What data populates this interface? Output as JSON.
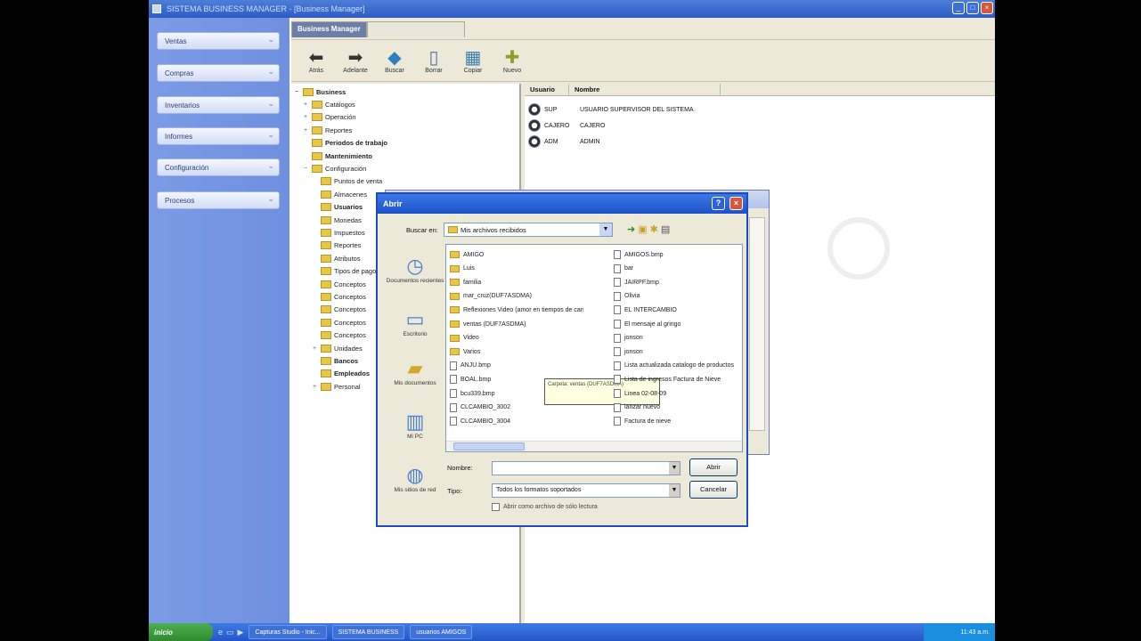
{
  "window": {
    "title": "SISTEMA BUSINESS MANAGER - [Business Manager]"
  },
  "leftnav": {
    "items": [
      {
        "label": "Ventas"
      },
      {
        "label": "Compras"
      },
      {
        "label": "Inventarios"
      },
      {
        "label": "Informes"
      },
      {
        "label": "Configuración"
      },
      {
        "label": "Procesos"
      }
    ]
  },
  "tabs": [
    {
      "label": "Business Manager"
    },
    {
      "label": ""
    }
  ],
  "toolbar": {
    "buttons": [
      {
        "label": "Atrás",
        "icon": "back-arrow-icon"
      },
      {
        "label": "Adelante",
        "icon": "forward-arrow-icon"
      },
      {
        "label": "Buscar",
        "icon": "search-icon"
      },
      {
        "label": "Borrar",
        "icon": "trash-icon"
      },
      {
        "label": "Copiar",
        "icon": "grid-icon"
      },
      {
        "label": "Nuevo",
        "icon": "new-icon"
      }
    ]
  },
  "tree": {
    "items": [
      {
        "label": "Business",
        "bold": true,
        "exp": "−",
        "level": 0
      },
      {
        "label": "Catálogos",
        "exp": "+",
        "level": 1
      },
      {
        "label": "Operación",
        "exp": "+",
        "level": 1
      },
      {
        "label": "Reportes",
        "exp": "+",
        "level": 1
      },
      {
        "label": "Periodos de trabajo",
        "bold": true,
        "exp": "",
        "level": 1
      },
      {
        "label": "Mantenimiento",
        "bold": true,
        "exp": "",
        "level": 1
      },
      {
        "label": "Configuración",
        "exp": "−",
        "level": 1
      },
      {
        "label": "Puntos de venta",
        "exp": "",
        "level": 2
      },
      {
        "label": "Almacenes",
        "exp": "",
        "level": 2
      },
      {
        "label": "Usuarios",
        "bold": true,
        "exp": "",
        "level": 2
      },
      {
        "label": "Monedas",
        "exp": "",
        "level": 2
      },
      {
        "label": "Impuestos",
        "exp": "",
        "level": 2
      },
      {
        "label": "Reportes",
        "exp": "",
        "level": 2
      },
      {
        "label": "Atributos",
        "exp": "",
        "level": 2
      },
      {
        "label": "Tipos de pago",
        "exp": "",
        "level": 2
      },
      {
        "label": "Conceptos",
        "exp": "",
        "level": 2
      },
      {
        "label": "Conceptos",
        "exp": "",
        "level": 2
      },
      {
        "label": "Conceptos",
        "exp": "",
        "level": 2
      },
      {
        "label": "Conceptos",
        "exp": "",
        "level": 2
      },
      {
        "label": "Conceptos",
        "exp": "",
        "level": 2
      },
      {
        "label": "Unidades",
        "exp": "+",
        "level": 2
      },
      {
        "label": "Bancos",
        "bold": true,
        "exp": "",
        "level": 2
      },
      {
        "label": "Empleados",
        "bold": true,
        "exp": "",
        "level": 2
      },
      {
        "label": "Personal",
        "exp": "+",
        "level": 2
      }
    ]
  },
  "list": {
    "headers": [
      "Usuario",
      "Nombre"
    ],
    "rows": [
      {
        "user": "SUP",
        "name": "USUARIO SUPERVISOR DEL SISTEMA"
      },
      {
        "user": "CAJERO",
        "name": "CAJERO"
      },
      {
        "user": "ADM",
        "name": "ADMIN"
      }
    ]
  },
  "dialog": {
    "title": "Abrir",
    "lookin_label": "Buscar en:",
    "lookin_value": "Mis archivos recibidos",
    "places": [
      {
        "label": "Documentos recientes",
        "icon": "recent-docs-icon"
      },
      {
        "label": "Escritorio",
        "icon": "desktop-icon"
      },
      {
        "label": "Mis documentos",
        "icon": "my-documents-icon"
      },
      {
        "label": "Mi PC",
        "icon": "my-computer-icon"
      },
      {
        "label": "Mis sitios de red",
        "icon": "network-icon"
      }
    ],
    "files_left": [
      {
        "name": "AMIGO",
        "type": "folder"
      },
      {
        "name": "Luis",
        "type": "folder"
      },
      {
        "name": "familia",
        "type": "folder"
      },
      {
        "name": "mar_cruz(DUF7ASDMA)",
        "type": "folder"
      },
      {
        "name": "Reflexiones Video (amor en tiempos de cancer)",
        "type": "folder"
      },
      {
        "name": "ventas (DUF7ASDMA)",
        "type": "folder"
      },
      {
        "name": "Video",
        "type": "folder"
      },
      {
        "name": "Varios",
        "type": "folder"
      },
      {
        "name": "ANJU.bmp",
        "type": "file"
      },
      {
        "name": "BOAL.bmp",
        "type": "file"
      },
      {
        "name": "bcu339.bmp",
        "type": "file"
      },
      {
        "name": "CLCAMBIO_3002",
        "type": "file"
      },
      {
        "name": "CLCAMBIO_3004",
        "type": "file"
      }
    ],
    "files_right": [
      {
        "name": "AMIGOS.bmp",
        "type": "file"
      },
      {
        "name": "bar",
        "type": "file"
      },
      {
        "name": "JAIRPF.bmp",
        "type": "file"
      },
      {
        "name": "Olivia",
        "type": "file"
      },
      {
        "name": "EL INTERCAMBIO",
        "type": "file"
      },
      {
        "name": "El mensaje al gringo",
        "type": "file"
      },
      {
        "name": "jonson",
        "type": "file"
      },
      {
        "name": "jonson",
        "type": "file"
      },
      {
        "name": "Lista actualizada catalogo de productos",
        "type": "file"
      },
      {
        "name": "Lista de ingresos Factura de Nieve",
        "type": "file"
      },
      {
        "name": "Linea 02-08-09",
        "type": "file"
      },
      {
        "name": "lanzar nuevo",
        "type": "file"
      },
      {
        "name": "Factura de nieve",
        "type": "file"
      }
    ],
    "tooltip": "Carpeta: ventas (DUF7ASDMA)",
    "filename_label": "Nombre:",
    "filename_value": "",
    "filetype_label": "Tipo:",
    "filetype_value": "Todos los formatos soportados",
    "open_button": "Abrir",
    "cancel_button": "Cancelar",
    "readonly_label": "Abrir como archivo de sólo lectura"
  },
  "taskbar": {
    "start_label": "inicio",
    "tasks": [
      {
        "label": "Capturas Studio - Inic..."
      },
      {
        "label": "SISTEMA BUSINESS"
      },
      {
        "label": "usuarios AMIGOS"
      }
    ],
    "clock": "11:43 a.m."
  }
}
